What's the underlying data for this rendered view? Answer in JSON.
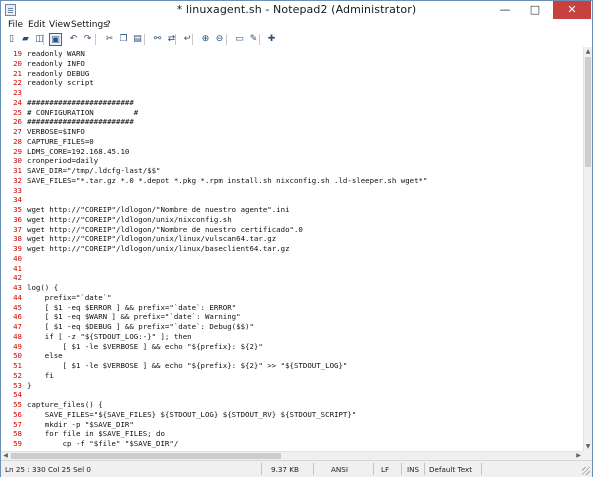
{
  "window": {
    "title": "* linuxagent.sh - Notepad2 (Administrator)"
  },
  "menu": [
    "File",
    "Edit",
    "View",
    "Settings",
    "?"
  ],
  "toolbar": {
    "buttons": [
      {
        "icon": "new-file-icon",
        "glyph": "▯"
      },
      {
        "icon": "open-folder-icon",
        "glyph": "▰"
      },
      {
        "icon": "browse-icon",
        "glyph": "◫"
      },
      {
        "icon": "save-icon",
        "glyph": "▣",
        "active": true
      },
      {
        "icon": "undo-icon",
        "glyph": "↶"
      },
      {
        "icon": "redo-icon",
        "glyph": "↷"
      },
      {
        "icon": "cut-icon",
        "glyph": "✂"
      },
      {
        "icon": "copy-icon",
        "glyph": "❐"
      },
      {
        "icon": "paste-icon",
        "glyph": "▤"
      },
      {
        "icon": "find-icon",
        "glyph": "⚯"
      },
      {
        "icon": "replace-icon",
        "glyph": "⇄"
      },
      {
        "icon": "word-wrap-icon",
        "glyph": "↵"
      },
      {
        "icon": "zoom-in-icon",
        "glyph": "⊕"
      },
      {
        "icon": "zoom-out-icon",
        "glyph": "⊖"
      },
      {
        "icon": "select-scheme-icon",
        "glyph": "▭"
      },
      {
        "icon": "customize-scheme-icon",
        "glyph": "✎"
      },
      {
        "icon": "favorites-icon",
        "glyph": "✚"
      }
    ]
  },
  "editor": {
    "lines": [
      {
        "n": "19",
        "text": "readonly WARN"
      },
      {
        "n": "20",
        "text": "readonly INFO"
      },
      {
        "n": "21",
        "text": "readonly DEBUG"
      },
      {
        "n": "22",
        "text": "readonly script"
      },
      {
        "n": "23",
        "text": ""
      },
      {
        "n": "24",
        "text": "########################"
      },
      {
        "n": "25",
        "text": "# CONFIGURATION         #"
      },
      {
        "n": "26",
        "text": "########################"
      },
      {
        "n": "27",
        "text": "VERBOSE=$INFO"
      },
      {
        "n": "28",
        "text": "CAPTURE_FILES=0"
      },
      {
        "n": "29",
        "text": "LDMS_CORE=192.168.45.10"
      },
      {
        "n": "30",
        "text": "cronperiod=daily"
      },
      {
        "n": "31",
        "text": "SAVE_DIR=\"/tmp/.ldcfg-last/$$\""
      },
      {
        "n": "32",
        "text": "SAVE_FILES=\"*.tar.gz *.0 *.depot *.pkg *.rpm install.sh nixconfig.sh .ld-sleeper.sh wget*\""
      },
      {
        "n": "33",
        "text": ""
      },
      {
        "n": "34",
        "text": ""
      },
      {
        "n": "35",
        "text": "wget http://\"COREIP\"/ldlogon/\"Nombre de nuestro agente\".ini"
      },
      {
        "n": "36",
        "text": "wget http://\"COREIP\"/ldlogon/unix/nixconfig.sh"
      },
      {
        "n": "37",
        "text": "wget http://\"COREIP\"/ldlogon/\"Nombre de nuestro certificado\".0"
      },
      {
        "n": "38",
        "text": "wget http://\"COREIP\"/ldlogon/unix/linux/vulscan64.tar.gz"
      },
      {
        "n": "39",
        "text": "wget http://\"COREIP\"/ldlogon/unix/linux/baseclient64.tar.gz"
      },
      {
        "n": "40",
        "text": ""
      },
      {
        "n": "41",
        "text": ""
      },
      {
        "n": "42",
        "text": ""
      },
      {
        "n": "43",
        "text": "log() {"
      },
      {
        "n": "44",
        "text": "    prefix=\"`date`\""
      },
      {
        "n": "45",
        "text": "    [ $1 -eq $ERROR ] && prefix=\"`date`: ERROR\""
      },
      {
        "n": "46",
        "text": "    [ $1 -eq $WARN ] && prefix=\"`date`: Warning\""
      },
      {
        "n": "47",
        "text": "    [ $1 -eq $DEBUG ] && prefix=\"`date`: Debug($$)\""
      },
      {
        "n": "48",
        "text": "    if [ -z \"${STDOUT_LOG:-}\" ]; then"
      },
      {
        "n": "49",
        "text": "        [ $1 -le $VERBOSE ] && echo \"${prefix}: ${2}\""
      },
      {
        "n": "50",
        "text": "    else"
      },
      {
        "n": "51",
        "text": "        [ $1 -le $VERBOSE ] && echo \"${prefix}: ${2}\" >> \"${STDOUT_LOG}\""
      },
      {
        "n": "52",
        "text": "    fi"
      },
      {
        "n": "53",
        "text": "}"
      },
      {
        "n": "54",
        "text": ""
      },
      {
        "n": "55",
        "text": "capture_files() {"
      },
      {
        "n": "56",
        "text": "    SAVE_FILES=\"${SAVE_FILES} ${STDOUT_LOG} ${STDOUT_RV} ${STDOUT_SCRIPT}\""
      },
      {
        "n": "57",
        "text": "    mkdir -p \"$SAVE_DIR\""
      },
      {
        "n": "58",
        "text": "    for file in $SAVE_FILES; do"
      },
      {
        "n": "59",
        "text": "        cp -f \"$file\" \"$SAVE_DIR\"/"
      }
    ]
  },
  "status": {
    "position": "Ln 25 : 330   Col 25   Sel 0",
    "size": "9.37 KB",
    "encoding": "ANSI",
    "line_endings": "LF",
    "mode": "INS",
    "scheme": "Default Text"
  },
  "colors": {
    "line_number": "#d10000",
    "close_button": "#c7423e"
  }
}
